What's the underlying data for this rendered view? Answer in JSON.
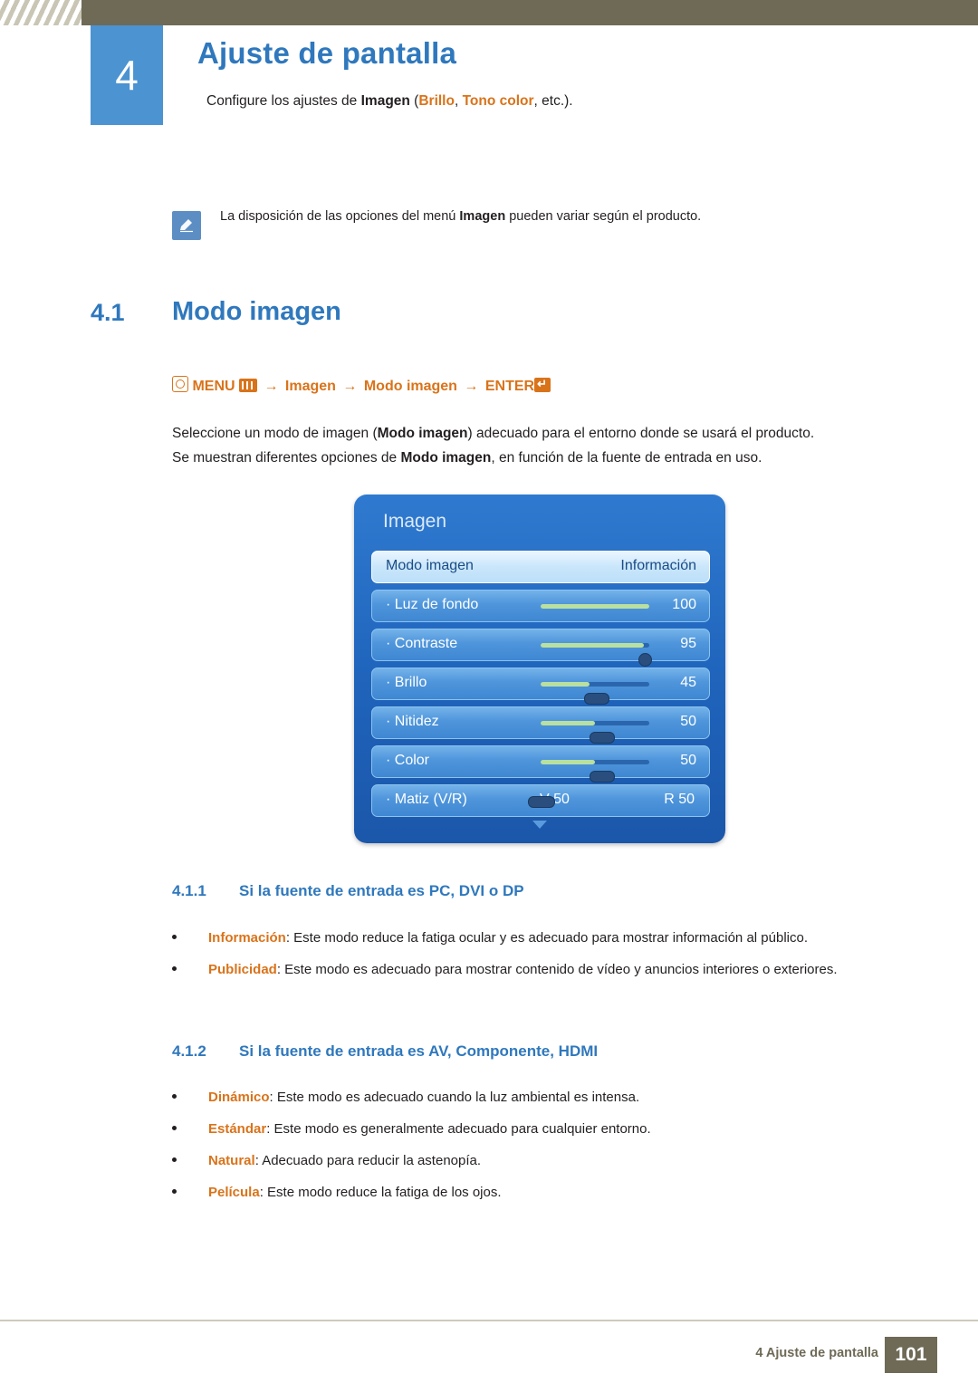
{
  "header": {
    "chapter_number": "4",
    "chapter_title": "Ajuste de pantalla",
    "chapter_sub_pre": "Configure los ajustes de ",
    "chapter_sub_b1": "Imagen",
    "chapter_sub_mid": " (",
    "chapter_sub_b2": "Brillo",
    "chapter_sub_sep": ", ",
    "chapter_sub_b3": "Tono color",
    "chapter_sub_post": ", etc.)."
  },
  "note": {
    "icon": "note-pencil-icon",
    "text_pre": "La disposición de las opciones del menú ",
    "text_bold": "Imagen",
    "text_post": " pueden variar según el producto."
  },
  "section": {
    "number": "4.1",
    "title": "Modo imagen"
  },
  "menu_path": {
    "menu_label": "MENU",
    "item1": "Imagen",
    "item2": "Modo imagen",
    "enter_label": "ENTER",
    "arrow": "→"
  },
  "paragraphs": {
    "p1_pre": "Seleccione un modo de imagen (",
    "p1_b": "Modo imagen",
    "p1_post": ") adecuado para el entorno donde se usará el producto.",
    "p2_pre": "Se muestran diferentes opciones de ",
    "p2_b": "Modo imagen",
    "p2_post": ", en función de la fuente de entrada en uso."
  },
  "osd": {
    "title": "Imagen",
    "rows": [
      {
        "label": "Modo imagen",
        "value": "Información",
        "type": "select"
      },
      {
        "label": "· Luz de fondo",
        "value": "100",
        "type": "slider",
        "fill": 100
      },
      {
        "label": "· Contraste",
        "value": "95",
        "type": "slider",
        "fill": 95
      },
      {
        "label": "· Brillo",
        "value": "45",
        "type": "slider",
        "fill": 45
      },
      {
        "label": "· Nitidez",
        "value": "50",
        "type": "slider",
        "fill": 50
      },
      {
        "label": "· Color",
        "value": "50",
        "type": "slider",
        "fill": 50
      },
      {
        "label": "· Matiz (V/R)",
        "value_v": "V 50",
        "value_r": "R 50",
        "type": "dual"
      }
    ]
  },
  "sub1": {
    "number": "4.1.1",
    "title": "Si la fuente de entrada es PC, DVI o DP",
    "bullets": [
      {
        "term": "Información",
        "text": ": Este modo reduce la fatiga ocular y es adecuado para mostrar información al público."
      },
      {
        "term": "Publicidad",
        "text": ": Este modo es adecuado para mostrar contenido de vídeo y anuncios interiores o exteriores."
      }
    ]
  },
  "sub2": {
    "number": "4.1.2",
    "title": "Si la fuente de entrada es AV, Componente, HDMI",
    "bullets": [
      {
        "term": "Dinámico",
        "text": ": Este modo es adecuado cuando la luz ambiental es intensa."
      },
      {
        "term": "Estándar",
        "text": ": Este modo es generalmente adecuado para cualquier entorno."
      },
      {
        "term": "Natural",
        "text": ": Adecuado para reducir la astenopía."
      },
      {
        "term": "Película",
        "text": ": Este modo reduce la fatiga de los ojos."
      }
    ]
  },
  "footer": {
    "text": "4 Ajuste de pantalla",
    "page": "101"
  },
  "colors": {
    "accent_blue": "#2f78bd",
    "accent_orange": "#d9731a",
    "header_olive": "#6e6a56",
    "chapter_box": "#4b93d1"
  }
}
